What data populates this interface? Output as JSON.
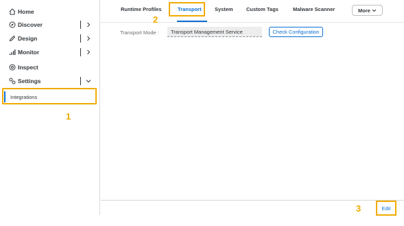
{
  "sidebar": {
    "items": [
      {
        "label": "Home",
        "icon": "home-icon"
      },
      {
        "label": "Discover",
        "icon": "compass-icon",
        "chevron": "›"
      },
      {
        "label": "Design",
        "icon": "pencil-icon",
        "chevron": "›"
      },
      {
        "label": "Monitor",
        "icon": "bar-chart-icon",
        "chevron": "›"
      },
      {
        "label": "Inspect",
        "icon": "inspect-icon"
      },
      {
        "label": "Settings",
        "icon": "settings-icon",
        "chevron": "⌄"
      }
    ],
    "sub_item": {
      "label": "Integrations"
    }
  },
  "callouts": {
    "one": "1",
    "two": "2",
    "three": "3"
  },
  "tabs": [
    {
      "label": "Runtime Profiles"
    },
    {
      "label": "Transport"
    },
    {
      "label": "System"
    },
    {
      "label": "Custom Tags"
    },
    {
      "label": "Malware Scanner"
    }
  ],
  "more": {
    "label": "More"
  },
  "form": {
    "transport_mode_label": "Transport Mode :",
    "transport_mode_value": "Transport Management Service",
    "check_button": "Check Configuration"
  },
  "footer": {
    "edit_label": "Edit"
  },
  "colors": {
    "accent": "#0a6ed1",
    "highlight": "#f0ab00",
    "text": "#32363a"
  }
}
